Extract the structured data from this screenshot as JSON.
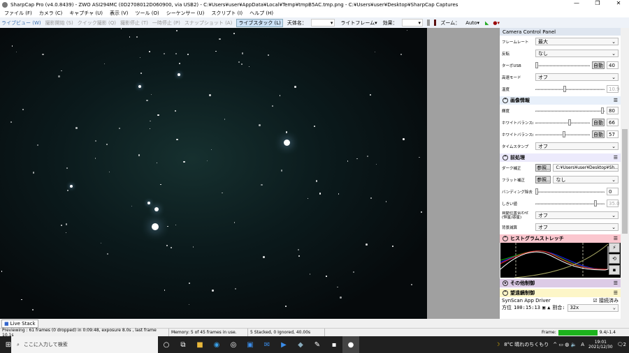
{
  "title": "SharpCap Pro (v4.0.8439) - ZWO ASI294MC (0D2708012D060900, via USB2) - C:¥Users¥user¥AppData¥Local¥Temp¥tmpB5AC.tmp.png - C:¥Users¥user¥Desktop¥SharpCap Captures",
  "menu": [
    "ファイル (F)",
    "カメラ (C)",
    "キャプチャ (U)",
    "表示 (V)",
    "ツール (O)",
    "シーケンサー (U)",
    "スクリプト (I)",
    "ヘルプ (H)"
  ],
  "toolbar": {
    "live_view": "ライブビュー (W)",
    "start_capture": "撮影開始 (S)",
    "quick_capture": "クイック撮影 (Q)",
    "stop_capture": "撮影停止 (T)",
    "pause": "一時停止 (P)",
    "snapshot": "スナップショット (A)",
    "live_stack": "ライブスタック (L)",
    "target_label": "天体名：",
    "target_value": "",
    "frame_type": "ライトフレーム",
    "effect_label": "効果：",
    "effect_value": "",
    "zoom_label": "ズーム：",
    "zoom_value": "Auto"
  },
  "panel": {
    "title": "Camera Control Panel",
    "rows1": [
      {
        "label": "フレームレート",
        "value": "最大"
      },
      {
        "label": "反転",
        "value": "なし"
      }
    ],
    "turbo": {
      "label": "ターボUSB",
      "auto": "自動",
      "value": "40"
    },
    "highspeed": {
      "label": "高速モード",
      "value": "オフ"
    },
    "temp": {
      "label": "温度",
      "value": "10.9"
    },
    "image_section": "画像情報",
    "brightness": {
      "label": "輝度",
      "value": "80"
    },
    "wb_r": {
      "label": "ホワイトバランス(R)",
      "auto": "自動",
      "value": "66"
    },
    "wb_b": {
      "label": "ホワイトバランス(B)",
      "auto": "自動",
      "value": "57"
    },
    "timestamp": {
      "label": "タイムスタンプ",
      "value": "オフ"
    },
    "pre_section": "前処理",
    "dark": {
      "label": "ダーク補正",
      "browse": "参照..",
      "value": "C:¥Users¥user¥Desktop¥Sh..."
    },
    "flat": {
      "label": "フラット補正",
      "browse": "参照..",
      "value": "なし"
    },
    "banding": {
      "label": "バンディング除去",
      "value": "0"
    },
    "threshold": {
      "label": "しきい値",
      "value": "35.0"
    },
    "align": {
      "label": "自動位置合わせ(恒星/惑星)",
      "value": "オフ"
    },
    "bg": {
      "label": "背景減算",
      "value": "オフ"
    },
    "hist_section": "ヒストグラムストレッチ",
    "other_section": "その他制御",
    "scope_section": "望遠鏡制御",
    "driver": "SynScan App Driver",
    "connected": "接続済み",
    "azimuth_label": "方位",
    "azimuth": "100:15:13",
    "rate_label": "割合:",
    "rate": "32x"
  },
  "livestack_tab": "Live Stack",
  "status": {
    "preview": "Previewing : 61 frames (0 dropped) in 0:09:48, exposure 8.0s , last frame 10.1s",
    "memory": "Memory: 5 of 45 frames in use.",
    "stacked": "5 Stacked, 0 Ignored, 40.00s",
    "frame_label": "Frame:",
    "frame_value": "9.4/-1.4"
  },
  "taskbar": {
    "search": "ここに入力して検索",
    "weather": "8°C 晴れのちくもり",
    "ime": "A",
    "time": "19:01",
    "date": "2021/12/30",
    "notif": "2"
  }
}
